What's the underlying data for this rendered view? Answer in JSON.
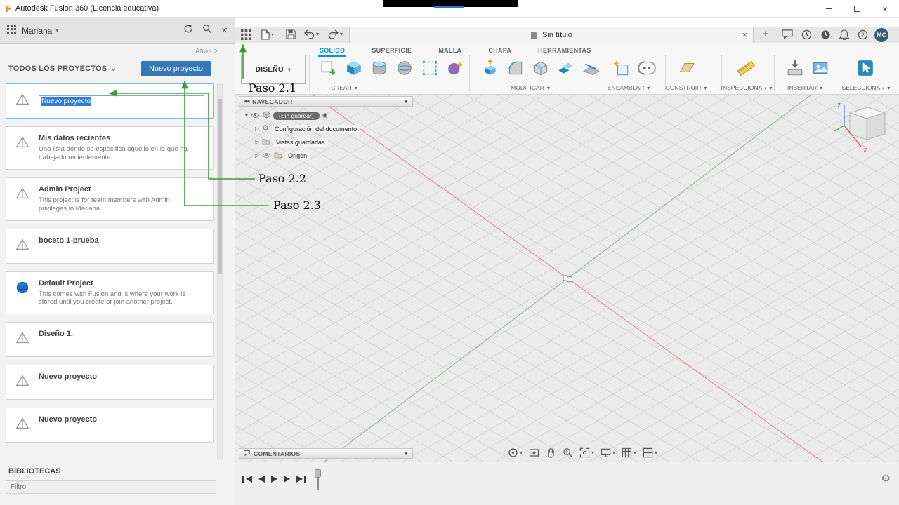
{
  "window": {
    "title": "Autodesk Fusion 360 (Licencia educativa)"
  },
  "data_panel": {
    "user_name": "Mariana",
    "back_link": "Atrás >",
    "section_title": "TODOS LOS PROYECTOS",
    "new_project_button": "Nuevo proyecto",
    "name_input_value": "Nuevo proyecto",
    "projects": [
      {
        "title": "Mis datos recientes",
        "description": "Una lista donde se especifica aquello en lo que ha trabajado recientemente"
      },
      {
        "title": "Admin Project",
        "description": "This project is for team members with Admin privileges in Mariana"
      },
      {
        "title": "boceto 1-prueba",
        "description": ""
      },
      {
        "title": "Default Project",
        "description": "This comes with Fusion and is where your work is stored until you create or join another project."
      },
      {
        "title": "Diseño 1.",
        "description": ""
      },
      {
        "title": "Nuevo proyecto",
        "description": ""
      },
      {
        "title": "Nuevo proyecto",
        "description": ""
      }
    ],
    "libraries_title": "BIBLIOTECAS",
    "filter_placeholder": "Filtro"
  },
  "quick_toolbar": {
    "tab_title": "Sin título",
    "avatar_initials": "MC"
  },
  "ribbon": {
    "workspace_label": "DISEÑO",
    "tabs": [
      {
        "label": "SOLIDO"
      },
      {
        "label": "SUPERFICIE"
      },
      {
        "label": "MALLA"
      },
      {
        "label": "CHAPA"
      },
      {
        "label": "HERRAMIENTAS"
      }
    ],
    "groups": [
      {
        "label": "CREAR"
      },
      {
        "label": "MODIFICAR"
      },
      {
        "label": "ENSAMBLAR"
      },
      {
        "label": "CONSTRUIR"
      },
      {
        "label": "INSPECCIONAR"
      },
      {
        "label": "INSERTAR"
      },
      {
        "label": "SELECCIONAR"
      }
    ]
  },
  "navigator": {
    "title": "NAVEGADOR",
    "root_label": "(Sin guardar)",
    "items": [
      {
        "label": "Configuración del documento"
      },
      {
        "label": "Vistas guardadas"
      },
      {
        "label": "Origen"
      }
    ]
  },
  "comments_panel": {
    "title": "COMENTARIOS"
  },
  "viewcube": {
    "z": "Z",
    "x": "X"
  },
  "annotations": [
    {
      "label": "Paso 2.1"
    },
    {
      "label": "Paso 2.2"
    },
    {
      "label": "Paso 2.3"
    }
  ],
  "colors": {
    "accent_blue": "#0696d7",
    "button_blue": "#3876b5",
    "selection_blue": "#2e7cd6",
    "annotation_green": "#3f9c35",
    "axis_red": "#dd8181",
    "axis_green": "#8cbd8c"
  }
}
